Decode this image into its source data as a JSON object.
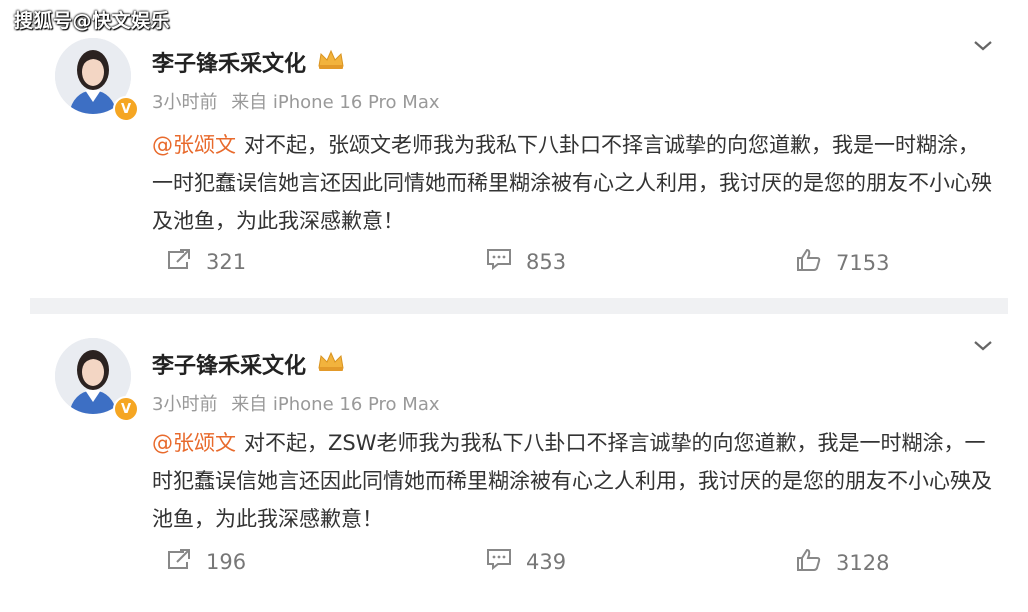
{
  "watermark": "搜狐号@快文娱乐",
  "posts": [
    {
      "author": "李子锋禾采文化",
      "time": "3小时前",
      "source": "来自 iPhone 16 Pro Max",
      "mention": "@张颂文",
      "text": "对不起，张颂文老师我为我私下八卦口不择言诚挚的向您道歉，我是一时糊涂，一时犯蠢误信她言还因此同情她而稀里糊涂被有心之人利用，我讨厌的是您的朋友不小心殃及池鱼，为此我深感歉意！",
      "shares": "321",
      "comments": "853",
      "likes": "7153"
    },
    {
      "author": "李子锋禾采文化",
      "time": "3小时前",
      "source": "来自 iPhone 16 Pro Max",
      "mention": "@张颂文",
      "text": "对不起，ZSW老师我为我私下八卦口不择言诚挚的向您道歉，我是一时糊涂，一时犯蠢误信她言还因此同情她而稀里糊涂被有心之人利用，我讨厌的是您的朋友不小心殃及池鱼，为此我深感歉意！",
      "shares": "196",
      "comments": "439",
      "likes": "3128"
    }
  ],
  "colors": {
    "mention": "#e86a2c",
    "verified_badge": "#f5a623",
    "separator": "#f0f1f3"
  },
  "icons": [
    "verified-v-icon",
    "crown-icon",
    "chevron-down-icon",
    "share-icon",
    "comment-icon",
    "like-icon"
  ]
}
